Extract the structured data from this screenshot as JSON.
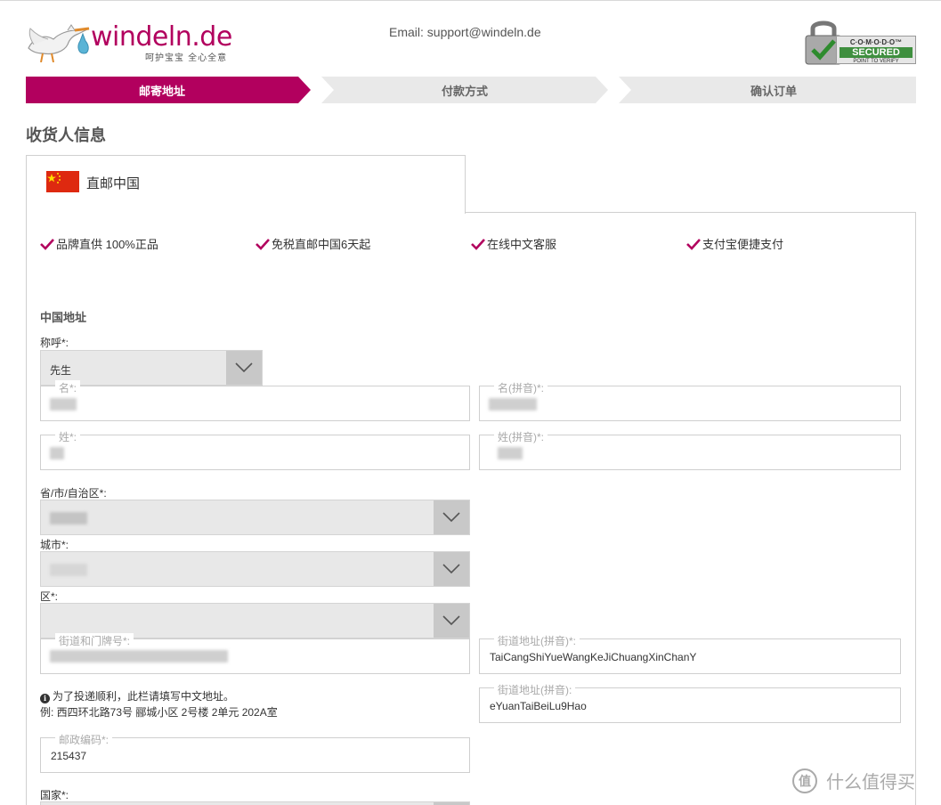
{
  "header": {
    "brand": "windeln.de",
    "slogan": "呵护宝宝 全心全意",
    "email": "Email: support@windeln.de",
    "ssl_badge": {
      "brand": "C·O·M·O·D·O™",
      "status": "SECURED",
      "tagline": "POINT TO VERIFY"
    }
  },
  "steps": [
    {
      "label": "邮寄地址",
      "active": true
    },
    {
      "label": "付款方式",
      "active": false
    },
    {
      "label": "确认订单",
      "active": false
    }
  ],
  "page_title": "收货人信息",
  "tab": {
    "label": "直邮中国",
    "flag_icon": "china-flag-icon"
  },
  "features": [
    "品牌直供 100%正品",
    "免税直邮中国6天起",
    "在线中文客服",
    "支付宝便捷支付"
  ],
  "form": {
    "section_title": "中国地址",
    "salutation": {
      "label": "称呼*:",
      "value": "先生"
    },
    "first_name": {
      "label": "名*:",
      "value": ""
    },
    "first_name_pinyin": {
      "label": "名(拼音)*:",
      "value": ""
    },
    "last_name": {
      "label": "姓*:",
      "value": ""
    },
    "last_name_pinyin": {
      "label": "姓(拼音)*:",
      "value": ""
    },
    "province": {
      "label": "省/市/自治区*:",
      "value": ""
    },
    "city": {
      "label": "城市*:",
      "value": ""
    },
    "district": {
      "label": "区*:",
      "value": ""
    },
    "street": {
      "label": "街道和门牌号*:",
      "value": ""
    },
    "street_pinyin": {
      "label": "街道地址(拼音)*:",
      "value": "TaiCangShiYueWangKeJiChuangXinChanY"
    },
    "street_pinyin_2": {
      "label": "街道地址(拼音):",
      "value": "eYuanTaiBeiLu9Hao"
    },
    "hint_line1": "为了投递顺利，此栏请填写中文地址。",
    "hint_line2": "例: 西四环北路73号 郦城小区 2号楼 2单元 202A室",
    "postal_code": {
      "label": "邮政编码*:",
      "value": "215437"
    },
    "country": {
      "label": "国家*:"
    }
  },
  "watermark": "什么值得买",
  "colors": {
    "accent": "#b2005e",
    "step_inactive": "#e9e9e9",
    "select_bg": "#e8e8e8"
  }
}
